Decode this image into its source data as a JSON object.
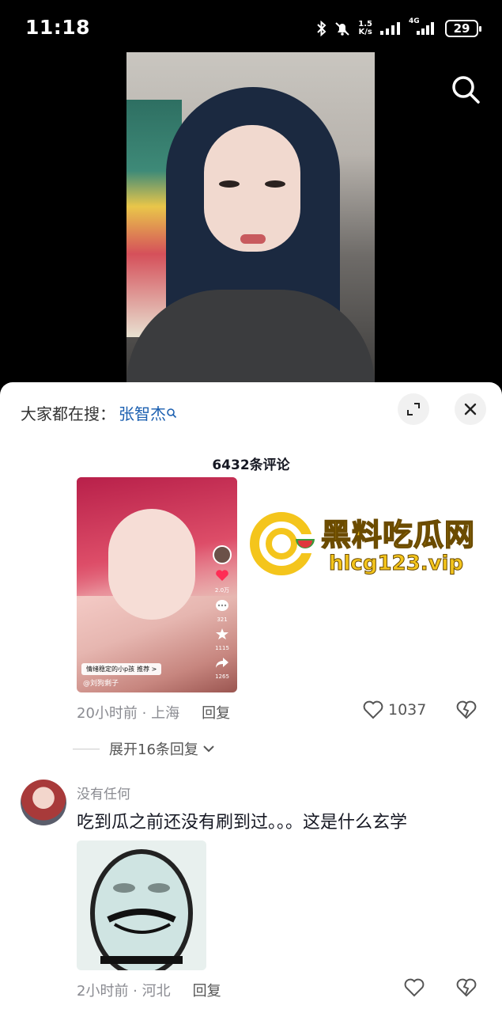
{
  "status_bar": {
    "time": "11:18",
    "network_speed_value": "1.5",
    "network_speed_unit": "K/s",
    "network_type": "4G",
    "battery": "29"
  },
  "video": {
    "search_icon": "search-icon"
  },
  "sheet": {
    "suggest_label": "大家都在搜：",
    "suggest_term": "张智杰",
    "comment_count": "6432条评论",
    "comment1": {
      "thumb_stats": [
        "2.0万",
        "321",
        "1115",
        "1265"
      ],
      "thumb_tag": "情绪稳定的小p孩",
      "thumb_tag_action": "推荐 >",
      "thumb_user": "@刘狗剩子",
      "time_location": "20小时前 · 上海",
      "reply": "回复",
      "likes": "1037",
      "expand_replies": "展开16条回复"
    },
    "comment2": {
      "username": "没有任何",
      "text": "吃到瓜之前还没有刷到过。。。这是什么玄学",
      "time_location": "2小时前 · 河北",
      "reply": "回复"
    }
  },
  "watermark": {
    "title": "黑料吃瓜网",
    "url": "hlcg123.vip"
  },
  "colors": {
    "accent_link": "#1b5fb0",
    "watermark_yellow": "#f4c51c",
    "watermark_green": "#3a9a3a",
    "watermark_red": "#e0383c"
  }
}
